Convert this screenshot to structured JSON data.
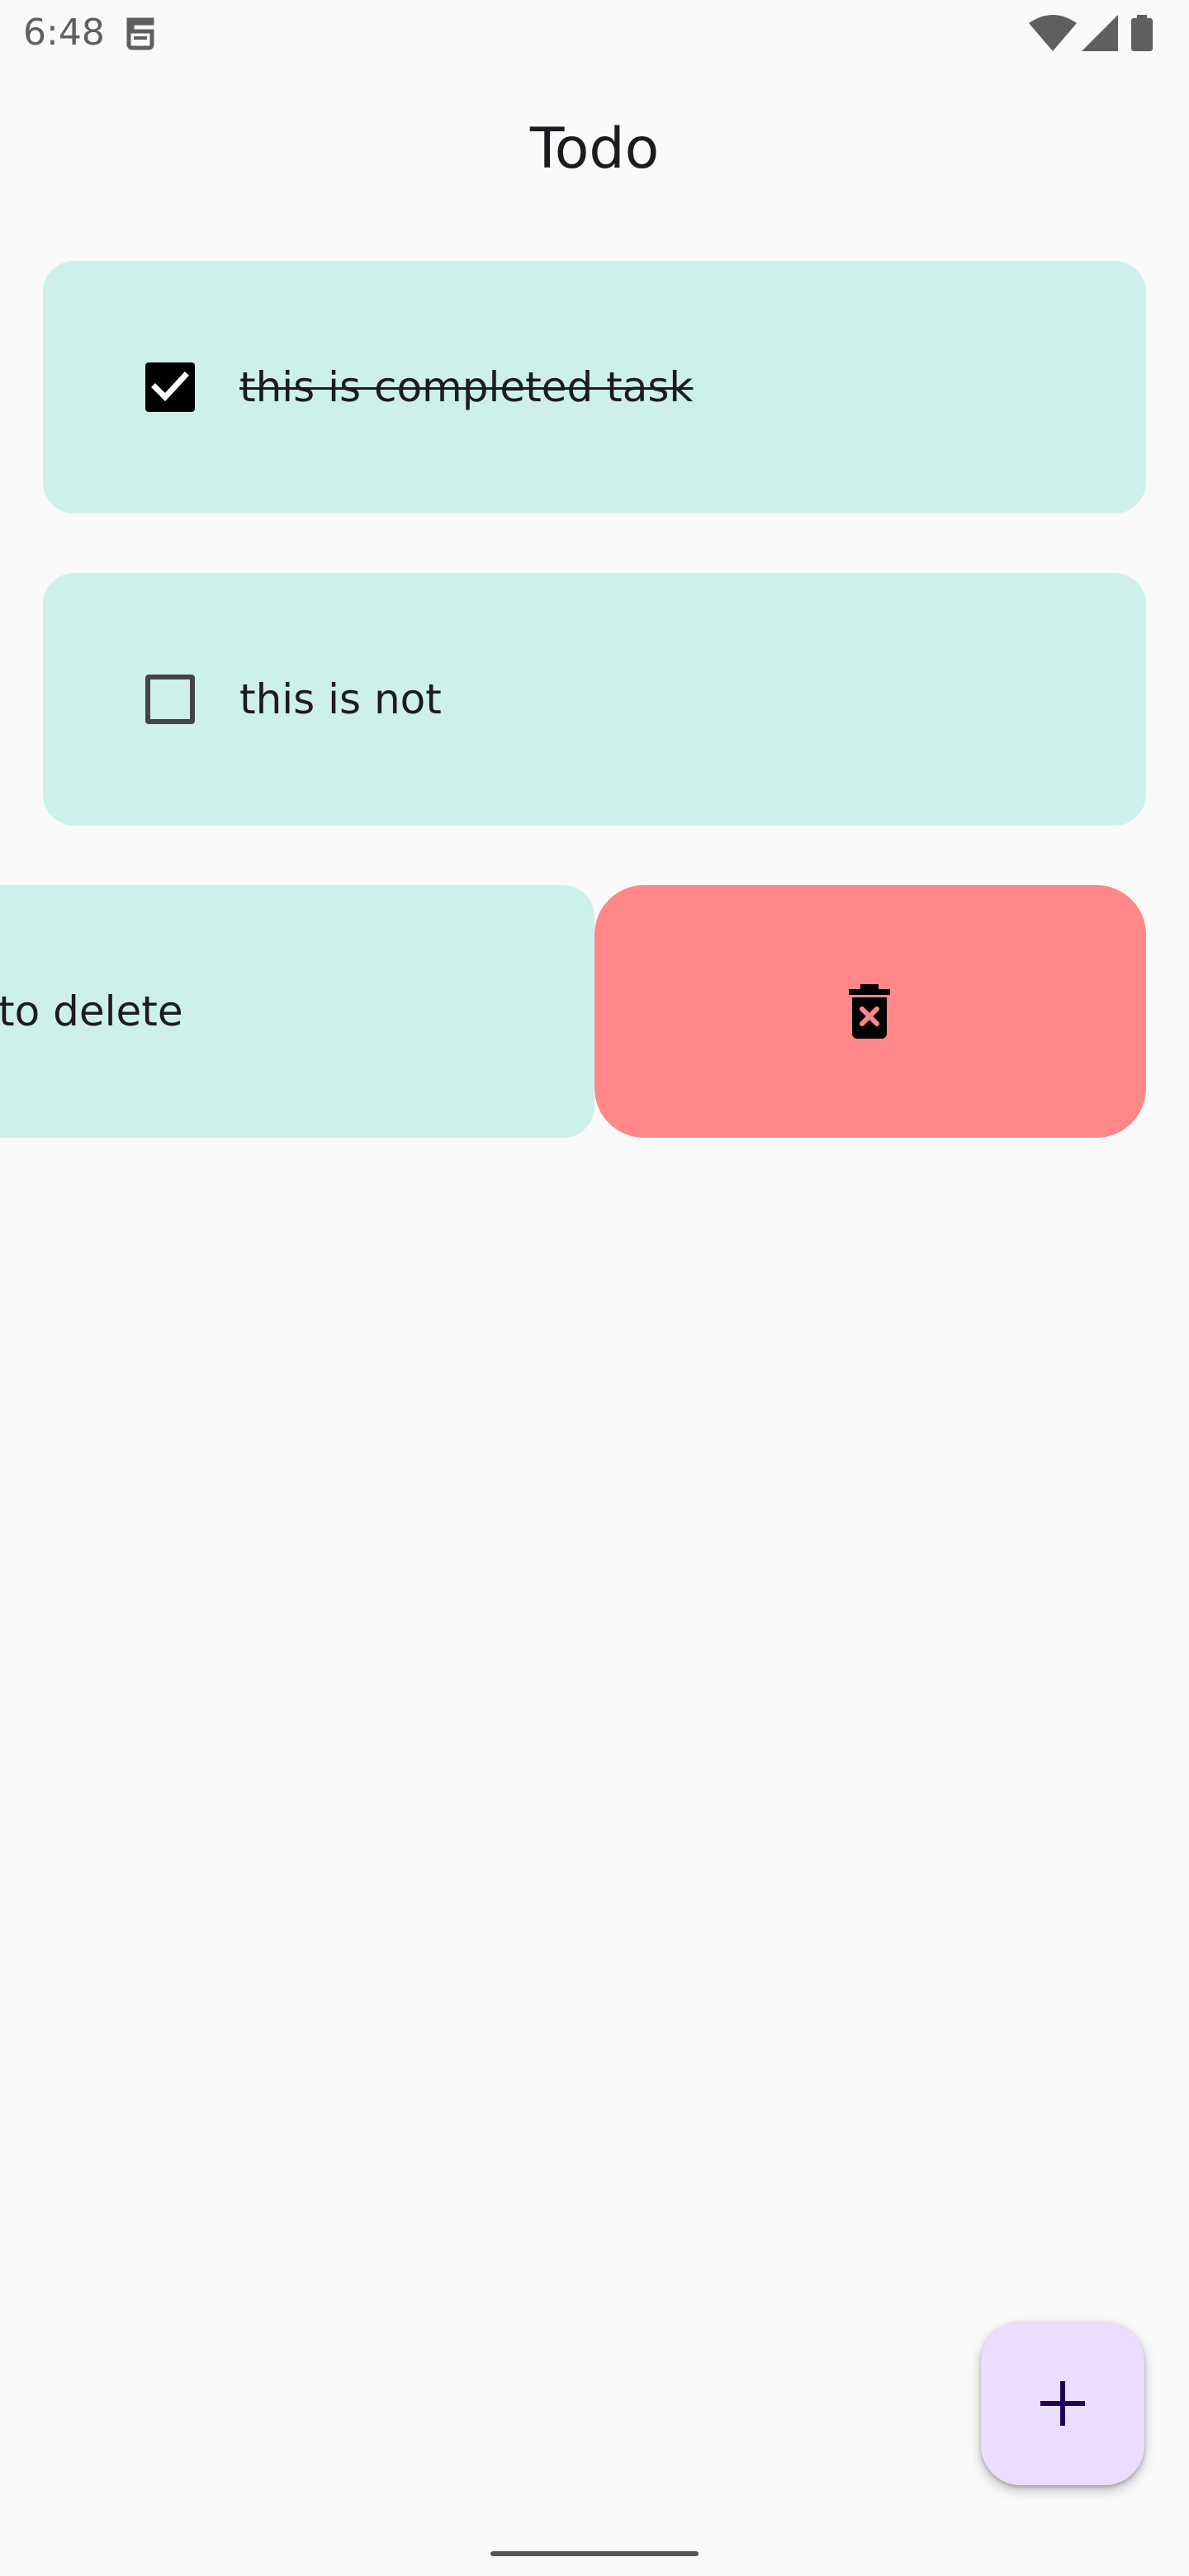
{
  "status_bar": {
    "time": "6:48",
    "icons": [
      "notification-icon",
      "wifi-icon",
      "cell-signal-icon",
      "battery-icon"
    ]
  },
  "app": {
    "title": "Todo"
  },
  "tasks": [
    {
      "text": "this is completed task",
      "completed": true
    },
    {
      "text": "this is not",
      "completed": false
    },
    {
      "text": "to delete",
      "completed": false,
      "swiped": true
    }
  ],
  "delete_action": {
    "icon": "delete-icon",
    "color": "#ff8787"
  },
  "fab": {
    "icon": "add-icon",
    "color": "#eaddff"
  },
  "colors": {
    "card": "#cdf0ea",
    "background": "#f9f9f9"
  }
}
